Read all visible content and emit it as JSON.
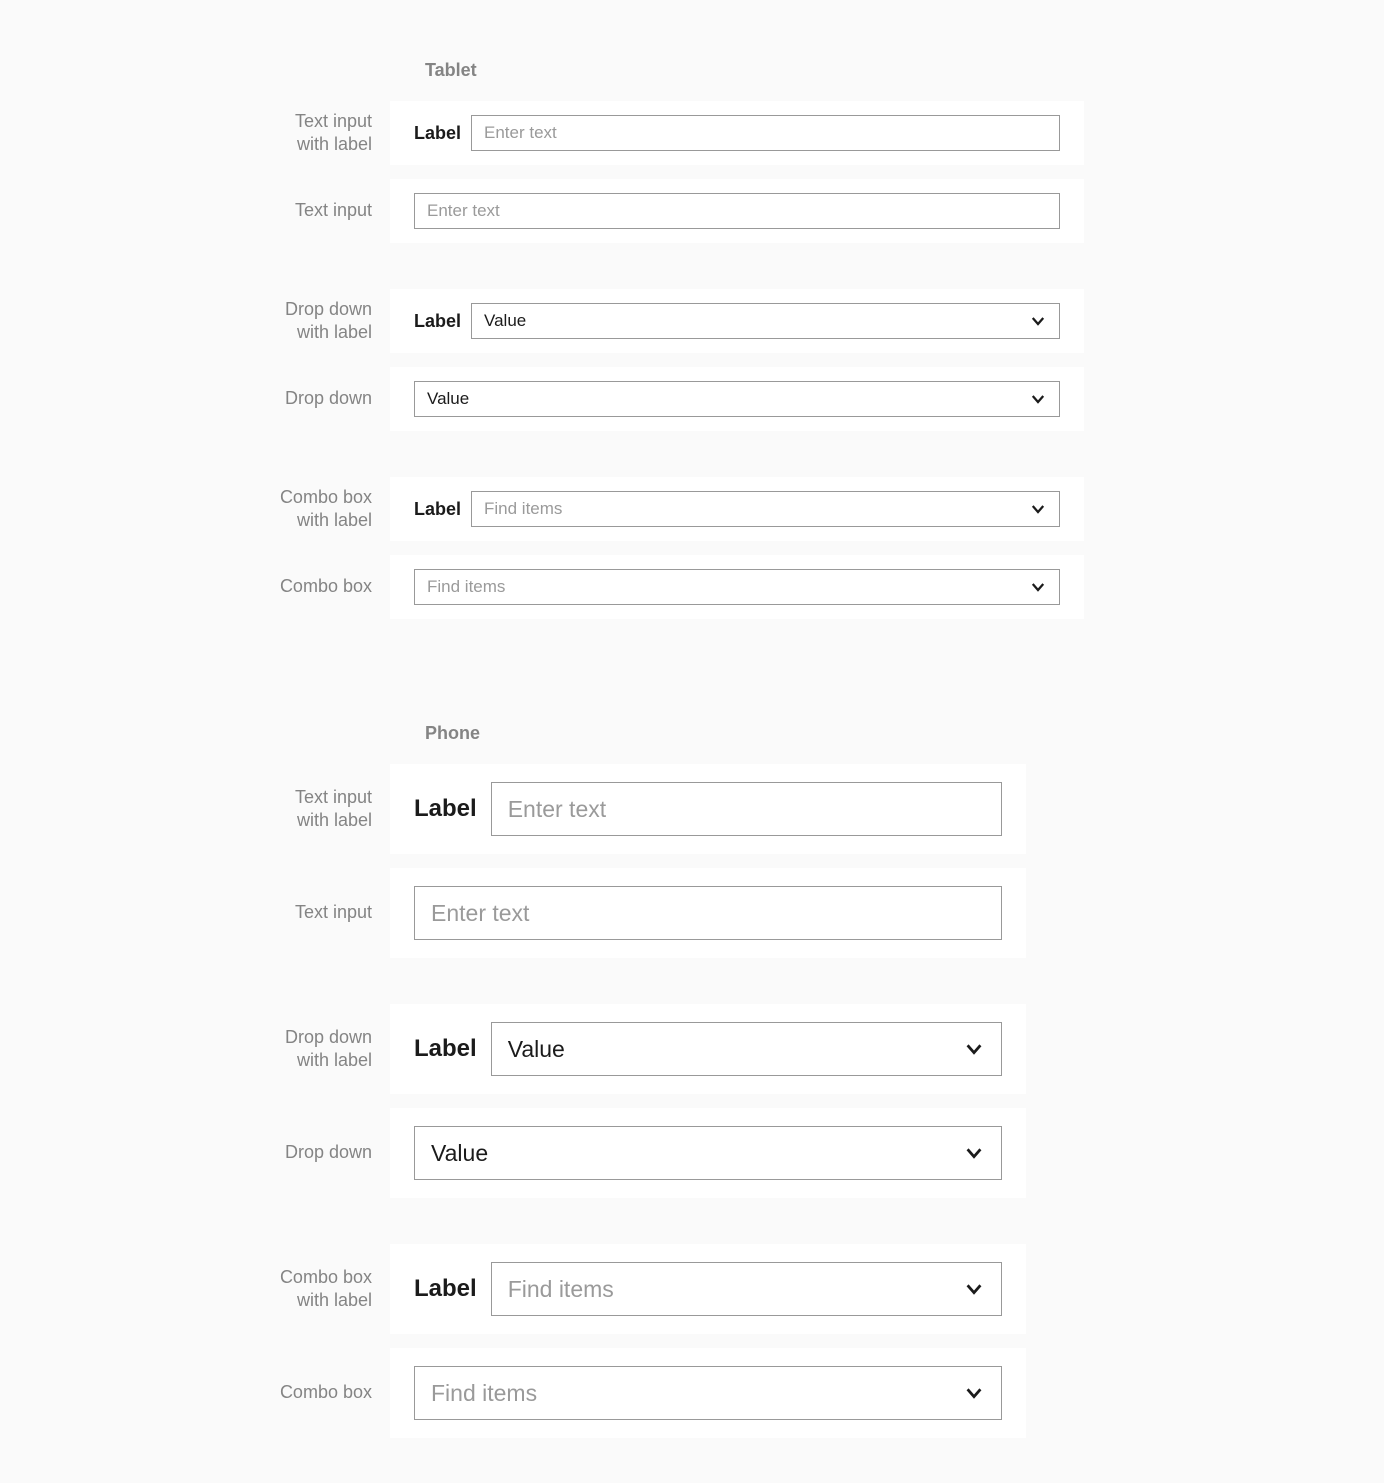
{
  "tablet": {
    "title": "Tablet",
    "rows": [
      {
        "desc1": "Text input",
        "desc2": "with label",
        "label": "Label",
        "placeholder": "Enter text"
      },
      {
        "desc1": "Text input",
        "placeholder": "Enter text"
      },
      {
        "desc1": "Drop down",
        "desc2": "with label",
        "label": "Label",
        "value": "Value"
      },
      {
        "desc1": "Drop down",
        "value": "Value"
      },
      {
        "desc1": "Combo box",
        "desc2": "with label",
        "label": "Label",
        "placeholder": "Find items"
      },
      {
        "desc1": "Combo box",
        "placeholder": "Find items"
      }
    ]
  },
  "phone": {
    "title": "Phone",
    "rows": [
      {
        "desc1": "Text input",
        "desc2": "with label",
        "label": "Label",
        "placeholder": "Enter text"
      },
      {
        "desc1": "Text input",
        "placeholder": "Enter text"
      },
      {
        "desc1": "Drop down",
        "desc2": "with label",
        "label": "Label",
        "value": "Value"
      },
      {
        "desc1": "Drop down",
        "value": "Value"
      },
      {
        "desc1": "Combo box",
        "desc2": "with label",
        "label": "Label",
        "placeholder": "Find items"
      },
      {
        "desc1": "Combo box",
        "placeholder": "Find items"
      }
    ]
  }
}
